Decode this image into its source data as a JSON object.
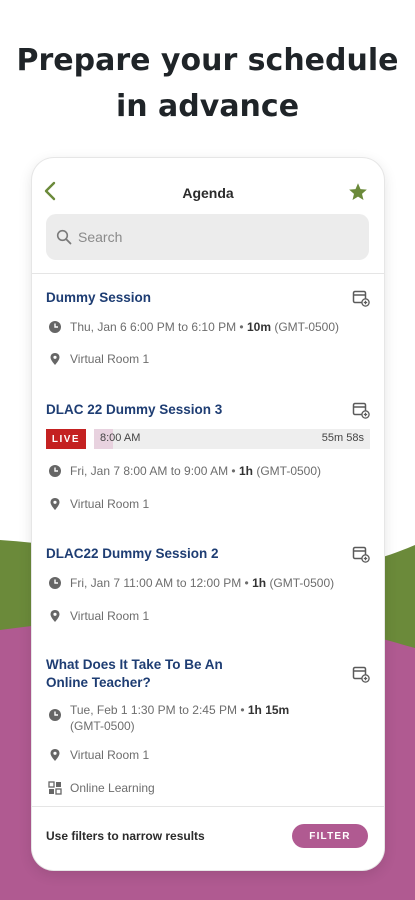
{
  "headline": {
    "line1": "Prepare your schedule",
    "line2": "in advance"
  },
  "colors": {
    "accent": "#b05a91",
    "green": "#6b8a3a",
    "live": "#c42121",
    "title_blue": "#1e3d73"
  },
  "app": {
    "title": "Agenda",
    "back_icon": "chevron-left-icon",
    "star_icon": "star-icon",
    "search": {
      "placeholder": "Search",
      "value": ""
    }
  },
  "sessions": [
    {
      "title": "Dummy Session",
      "time": "Thu, Jan 6 6:00 PM to 6:10 PM",
      "duration": "10m",
      "tz": "(GMT-0500)",
      "location": "Virtual Room 1"
    },
    {
      "title": "DLAC 22 Dummy Session 3",
      "live": {
        "badge": "LIVE",
        "start": "8:00 AM",
        "remaining": "55m 58s",
        "progress": 0.07
      },
      "time": "Fri, Jan 7 8:00 AM to 9:00 AM",
      "duration": "1h",
      "tz": "(GMT-0500)",
      "location": "Virtual Room 1"
    },
    {
      "title": "DLAC22 Dummy Session 2",
      "time": "Fri, Jan 7 11:00 AM to 12:00 PM",
      "duration": "1h",
      "tz": "(GMT-0500)",
      "location": "Virtual Room 1"
    },
    {
      "title": "What Does It Take To Be An Online Teacher?",
      "time": "Tue, Feb 1 1:30 PM to 2:45 PM",
      "duration": "1h 15m",
      "tz": "(GMT-0500)",
      "location": "Virtual Room 1",
      "track": "Online Learning"
    }
  ],
  "footer": {
    "text": "Use filters to narrow results",
    "button": "FILTER"
  }
}
